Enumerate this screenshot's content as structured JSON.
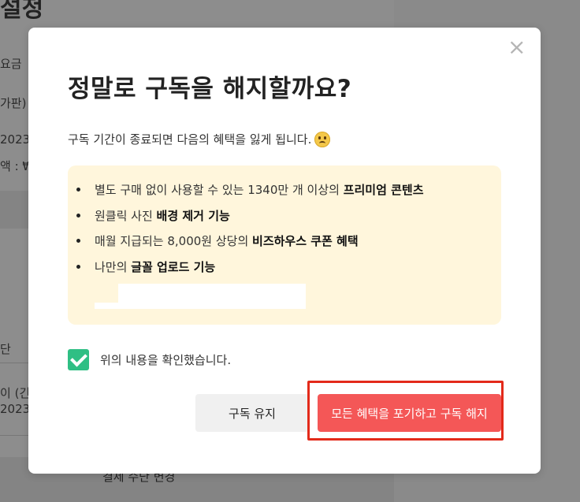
{
  "background": {
    "title_fragment": "설정",
    "lines": [
      "요금",
      "가판)",
      "2023",
      "액 : ₩",
      "단",
      "이 (긴",
      "2023"
    ],
    "bottom_text": "결제 수단 변경"
  },
  "modal": {
    "close_label": "×",
    "title": "정말로 구독을 해지할까요?",
    "description": "구독 기간이 종료되면 다음의 혜택을 잃게 됩니다.",
    "benefits": [
      {
        "prefix": "별도 구매 없이 사용할 수 있는 1340만 개 이상의 ",
        "bold": "프리미엄 콘텐츠",
        "suffix": ""
      },
      {
        "prefix": "원클릭 사진 ",
        "bold": "배경 제거 기능",
        "suffix": ""
      },
      {
        "prefix": "매월 지급되는 8,000원 상당의 ",
        "bold": "비즈하우스 쿠폰 혜택",
        "suffix": ""
      },
      {
        "prefix": "나만의 ",
        "bold": "글꼴 업로드 기능",
        "suffix": ""
      }
    ],
    "confirm_label": "위의 내용을 확인했습니다.",
    "confirm_checked": true,
    "keep_button": "구독 유지",
    "cancel_button": "모든 혜택을 포기하고 구독 해지"
  },
  "colors": {
    "accent_red": "#f45757",
    "highlight_border": "#e32a1a",
    "checkbox_green": "#2fbf84",
    "benefit_bg": "#fff6dc"
  },
  "icons": {
    "close": "close-icon",
    "emoji": "sad-face-icon",
    "checkbox": "checkmark-icon"
  }
}
